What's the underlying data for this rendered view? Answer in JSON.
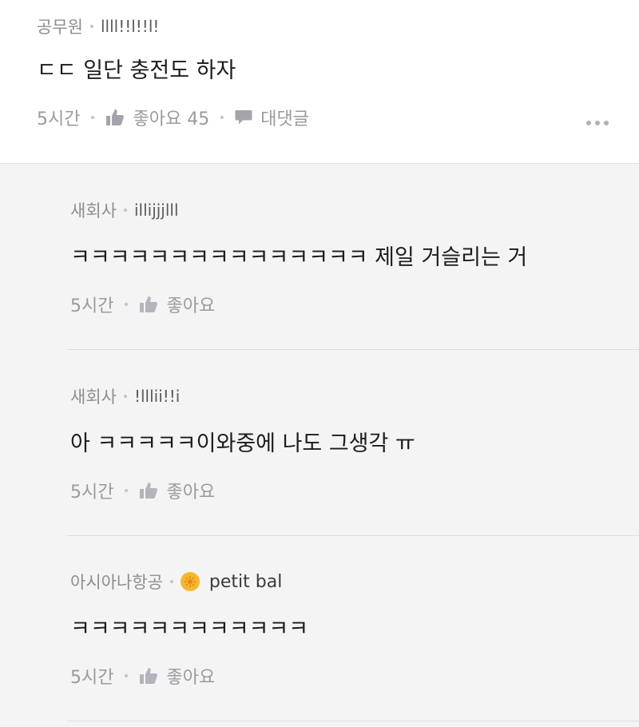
{
  "main_comment": {
    "company": "공무원",
    "nickname": "llll!!l!!l!",
    "text": "ㄷㄷ 일단 충전도 하자",
    "time": "5시간",
    "like_label": "좋아요 45",
    "reply_label": "대댓글"
  },
  "replies": [
    {
      "company": "새회사",
      "nickname": "illijjjlll",
      "text": "ㅋㅋㅋㅋㅋㅋㅋㅋㅋㅋㅋㅋㅋㅋㅋ 제일 거슬리는 거",
      "time": "5시간",
      "like_label": "좋아요"
    },
    {
      "company": "새회사",
      "nickname": "!lllii!!i",
      "text": "아 ㅋㅋㅋㅋㅋ이와중에 나도 그생각 ㅠ",
      "time": "5시간",
      "like_label": "좋아요"
    },
    {
      "company": "아시아나항공",
      "nickname": "petit bal",
      "text": "ㅋㅋㅋㅋㅋㅋㅋㅋㅋㅋㅋㅋ",
      "time": "5시간",
      "like_label": "좋아요"
    }
  ],
  "icons": {
    "like": "thumbs-up-icon",
    "reply": "speech-bubble-icon",
    "more": "more-dots-icon",
    "badge": "flower-badge-icon"
  },
  "colors": {
    "accent_badge": "#f5b82e",
    "muted_text": "#9a9aa0",
    "primary_text": "#1c1c1e"
  }
}
